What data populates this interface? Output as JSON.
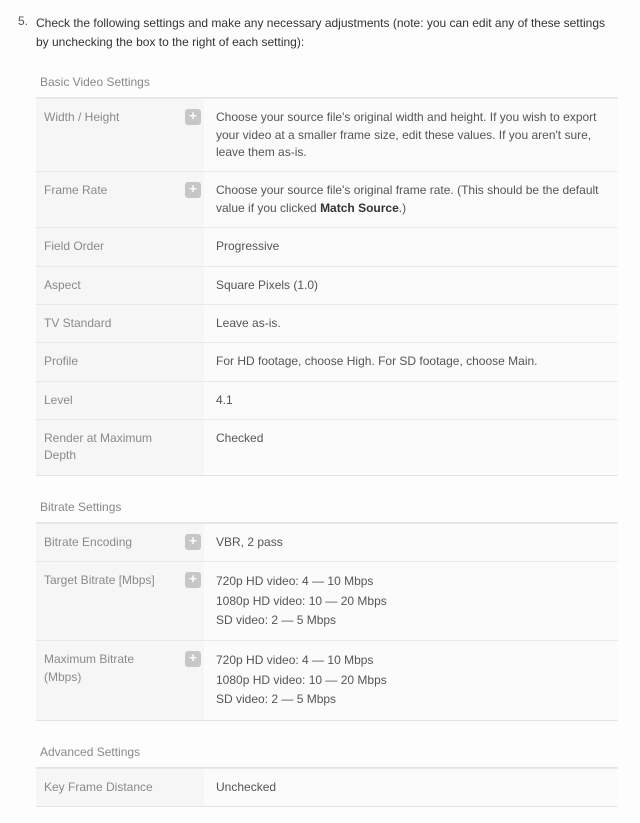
{
  "step": {
    "number": "5.",
    "text": "Check the following settings and make any necessary adjustments (note: you can edit any of these settings by unchecking the box to the right of each setting):"
  },
  "basic": {
    "title": "Basic Video Settings",
    "rows": {
      "width_height": {
        "label": "Width / Height",
        "desc": "Choose your source file's original width and height. If you wish to export your video at a smaller frame size, edit these values. If you aren't sure, leave them as-is."
      },
      "frame_rate": {
        "label": "Frame Rate",
        "desc_pre": "Choose your source file's original frame rate. (This should be the default value if you clicked ",
        "desc_bold": "Match Source",
        "desc_post": ".)"
      },
      "field_order": {
        "label": "Field Order",
        "desc": "Progressive"
      },
      "aspect": {
        "label": "Aspect",
        "desc": "Square Pixels (1.0)"
      },
      "tv_standard": {
        "label": "TV Standard",
        "desc": "Leave as-is."
      },
      "profile": {
        "label": "Profile",
        "desc": "For HD footage, choose High. For SD footage, choose Main."
      },
      "level": {
        "label": "Level",
        "desc": "4.1"
      },
      "render_max_depth": {
        "label": "Render at Maximum Depth",
        "desc": "Checked"
      }
    }
  },
  "bitrate": {
    "title": "Bitrate Settings",
    "rows": {
      "encoding": {
        "label": "Bitrate Encoding",
        "desc": "VBR, 2 pass"
      },
      "target": {
        "label": "Target Bitrate [Mbps]",
        "line1": "720p HD video: 4 — 10 Mbps",
        "line2": "1080p HD video: 10 — 20 Mbps",
        "line3": "SD video: 2 — 5 Mbps"
      },
      "max": {
        "label": "Maximum Bitrate (Mbps)",
        "line1": "720p HD video: 4 — 10 Mbps",
        "line2": "1080p HD video: 10 — 20 Mbps",
        "line3": "SD video: 2 — 5 Mbps"
      }
    }
  },
  "advanced": {
    "title": "Advanced Settings",
    "rows": {
      "key_frame": {
        "label": "Key Frame Distance",
        "desc": "Unchecked"
      }
    }
  }
}
